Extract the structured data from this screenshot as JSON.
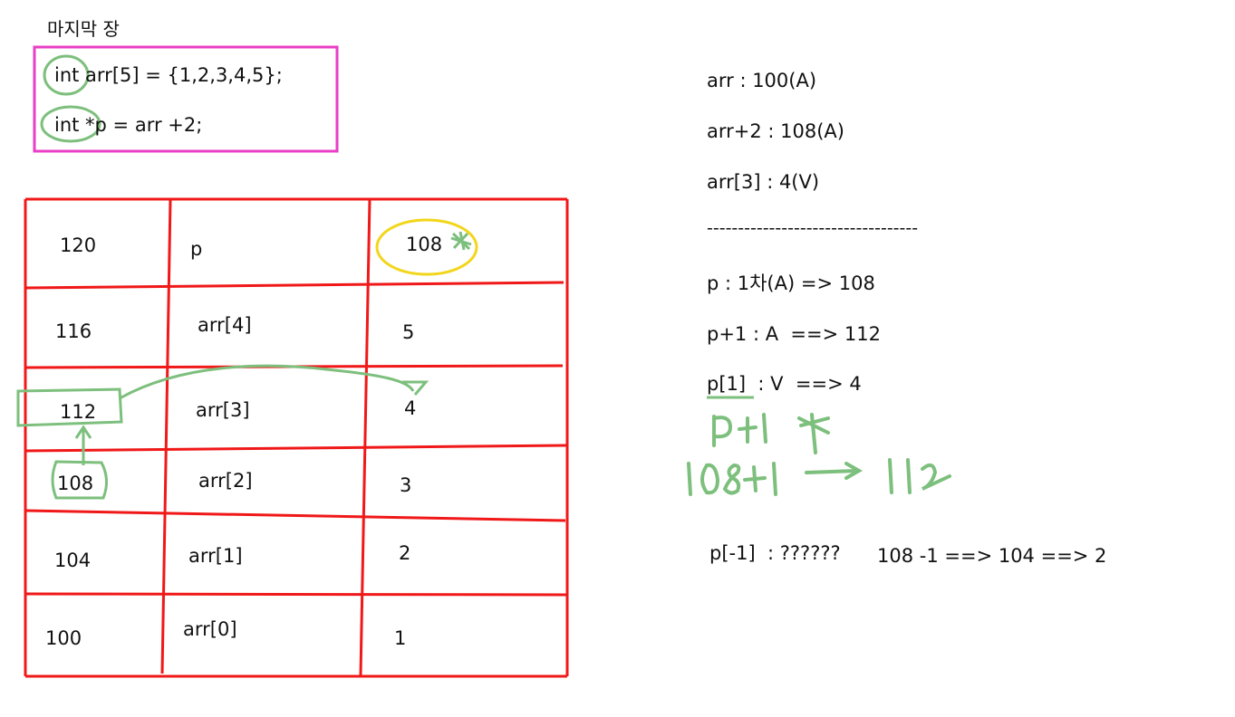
{
  "heading": "마지막 장",
  "code": {
    "line1": "int arr[5] = {1,2,3,4,5};",
    "line2": "int *p = arr +2;"
  },
  "memory_table": {
    "rows": [
      {
        "address": "120",
        "name": "p",
        "value": "108"
      },
      {
        "address": "116",
        "name": "arr[4]",
        "value": "5"
      },
      {
        "address": "112",
        "name": "arr[3]",
        "value": "4"
      },
      {
        "address": "108",
        "name": "arr[2]",
        "value": "3"
      },
      {
        "address": "104",
        "name": "arr[1]",
        "value": "2"
      },
      {
        "address": "100",
        "name": "arr[0]",
        "value": "1"
      }
    ]
  },
  "notes": {
    "arr": "arr : 100(A)",
    "arr_plus_2": "arr+2 : 108(A)",
    "arr_3": "arr[3] : 4(V)",
    "divider": "----------------------------------",
    "p": "p : 1차(A) => 108",
    "p_plus_1": "p+1 : A  ==> 112",
    "p_index_1": "p[1]  : V  ==> 4",
    "p_neg_1_label": "p[-1]  : ??????",
    "p_neg_1_calc": "108 -1 ==> 104 ==> 2"
  },
  "handwriting": {
    "line1": "p+1 *",
    "line2": "108+1 → 112"
  },
  "colors": {
    "code_box": "#e83fc6",
    "table_lines": "#f01818",
    "annotation_green": "#7dbf7d",
    "highlight_yellow": "#f2d61b",
    "text": "#111111"
  }
}
